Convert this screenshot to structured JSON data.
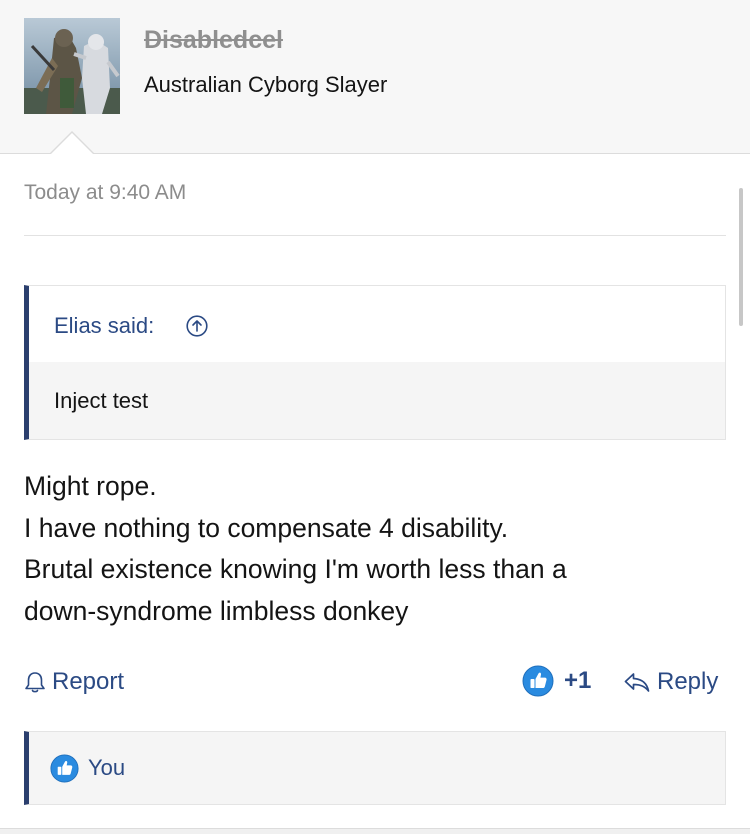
{
  "post": {
    "username": "Disabledcel",
    "user_title": "Australian Cyborg Slayer",
    "avatar_icon": "user-avatar",
    "timestamp": "Today at 9:40 AM",
    "quote": {
      "author_label": "Elias said:",
      "icon": "arrow-up-circle-icon",
      "text": "Inject test"
    },
    "message_lines": [
      "Might rope.",
      "I have nothing to compensate 4 disability.",
      "Brutal existence knowing I'm worth less than a",
      "down-syndrome limbless donkey"
    ],
    "actions": {
      "report_label": "Report",
      "like_count": "+1",
      "reply_label": "Reply"
    },
    "likes": {
      "names": "You"
    }
  },
  "colors": {
    "link": "#2b4a84",
    "quote_border": "#2b3f6e",
    "like_badge": "#2a8be0",
    "muted": "#8c8c8c"
  }
}
